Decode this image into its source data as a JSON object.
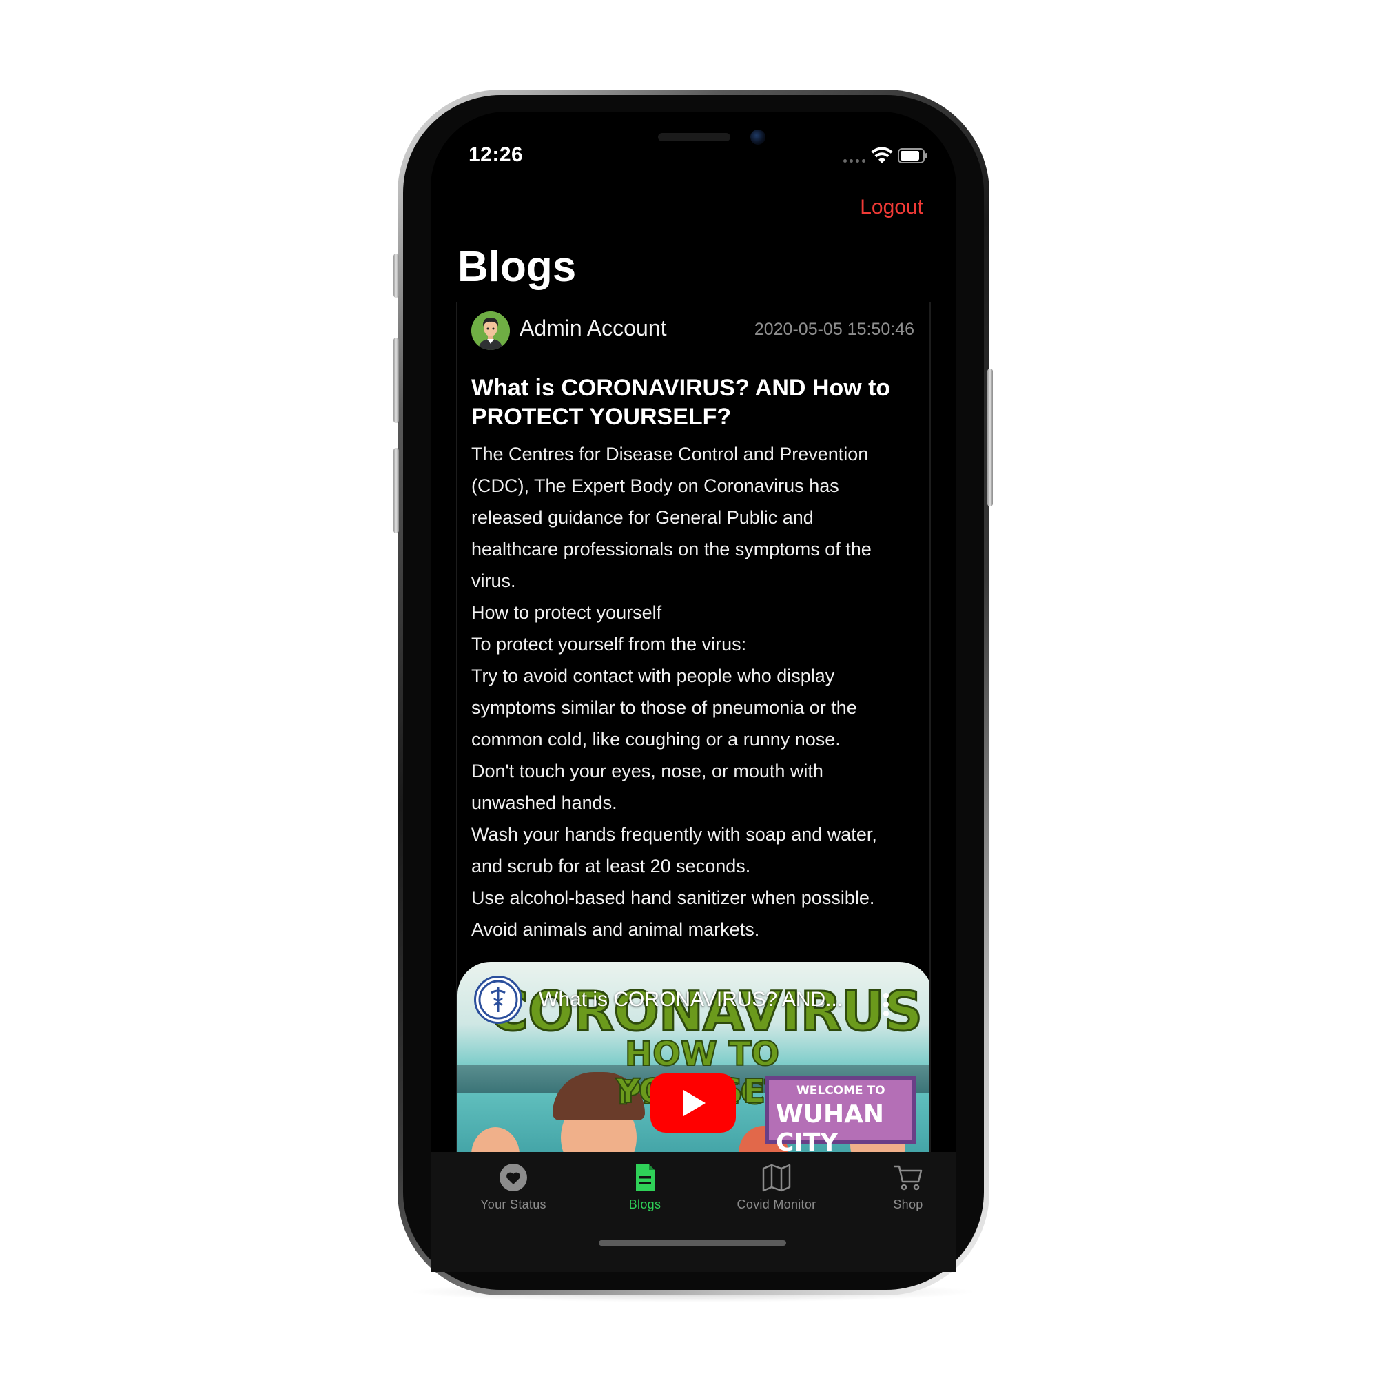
{
  "status_bar": {
    "time": "12:26"
  },
  "header": {
    "logout_label": "Logout",
    "title": "Blogs"
  },
  "post": {
    "author": "Admin Account",
    "date": "2020-05-05 15:50:46",
    "title_line1": "What is CORONAVIRUS? AND How to",
    "title_line2": "PROTECT YOURSELF?",
    "body_lines": [
      "The Centres for Disease Control and Prevention",
      "(CDC), The Expert Body on Coronavirus has",
      "released guidance for General Public and",
      "healthcare professionals on the symptoms of the",
      "virus.",
      "How to protect yourself",
      "To protect yourself from the virus:",
      "Try to avoid contact with people who display",
      "symptoms similar to those of pneumonia or the",
      "common cold, like coughing or a runny nose.",
      "Don't touch your eyes, nose, or mouth with",
      "unwashed hands.",
      "Wash your hands frequently with soap and water,",
      "and scrub for at least 20 seconds.",
      "Use alcohol-based hand sanitizer when possible.",
      "Avoid animals and animal markets."
    ],
    "video": {
      "overlay_title": "What is CORONAVIRUS? AND...",
      "headline": "CORONAVIRUS",
      "sub_line1": "HOW TO PROTECT",
      "sub_line2": "YOURSELF",
      "sign_line1": "WELCOME TO",
      "sign_line2": "WUHAN CITY"
    }
  },
  "tabs": [
    {
      "label": "Your Status",
      "icon": "heart-icon",
      "active": false
    },
    {
      "label": "Blogs",
      "icon": "document-icon",
      "active": true
    },
    {
      "label": "Covid Monitor",
      "icon": "map-icon",
      "active": false
    },
    {
      "label": "Shop",
      "icon": "cart-icon",
      "active": false
    }
  ],
  "colors": {
    "accent_active": "#2fd158",
    "logout": "#f13a36",
    "background": "#000000",
    "tab_inactive": "#8c8c8c"
  }
}
